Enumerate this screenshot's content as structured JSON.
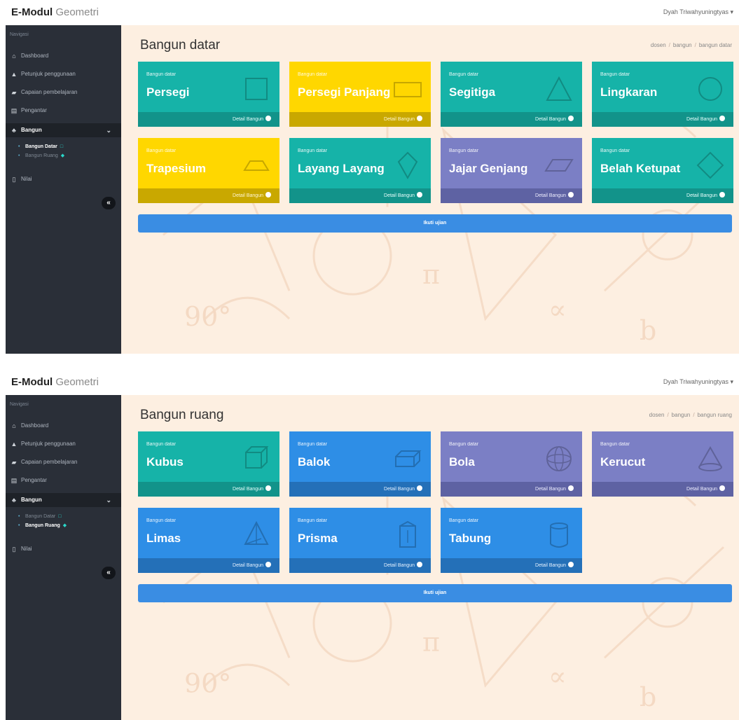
{
  "app": {
    "brand_bold": "E-Modul",
    "brand_light": "Geometri",
    "user": "Dyah Triwahyuningtyas ▾"
  },
  "nav": {
    "heading": "Navigasi",
    "items": [
      {
        "label": "Dashboard",
        "icon": "home-icon"
      },
      {
        "label": "Petunjuk penggunaan",
        "icon": "pointer-icon"
      },
      {
        "label": "Capaian pembelajaran",
        "icon": "graduation-cap-icon"
      },
      {
        "label": "Pengantar",
        "icon": "id-card-icon"
      },
      {
        "label": "Bangun",
        "icon": "shapes-icon"
      },
      {
        "label": "Nilai",
        "icon": "clipboard-icon"
      }
    ],
    "sub_items": [
      "Bangun Datar",
      "Bangun Ruang"
    ],
    "collapse": "«"
  },
  "screens": [
    {
      "title": "Bangun datar",
      "breadcrumb": [
        "dosen",
        "bangun",
        "bangun datar"
      ],
      "cards": [
        {
          "kicker": "Bangun datar",
          "title": "Persegi",
          "footer": "Detail Bangun",
          "color": "teal",
          "icon": "square-icon"
        },
        {
          "kicker": "Bangun datar",
          "title": "Persegi Panjang",
          "footer": "Detail Bangun",
          "color": "yellow",
          "icon": "rectangle-icon"
        },
        {
          "kicker": "Bangun datar",
          "title": "Segitiga",
          "footer": "Detail Bangun",
          "color": "teal",
          "icon": "triangle-icon"
        },
        {
          "kicker": "Bangun datar",
          "title": "Lingkaran",
          "footer": "Detail Bangun",
          "color": "teal",
          "icon": "circle-icon"
        },
        {
          "kicker": "Bangun datar",
          "title": "Trapesium",
          "footer": "Detail Bangun",
          "color": "yellow",
          "icon": "trapezoid-icon"
        },
        {
          "kicker": "Bangun datar",
          "title": "Layang Layang",
          "footer": "Detail Bangun",
          "color": "teal",
          "icon": "kite-icon"
        },
        {
          "kicker": "Bangun datar",
          "title": "Jajar Genjang",
          "footer": "Detail Bangun",
          "color": "purple",
          "icon": "parallelogram-icon"
        },
        {
          "kicker": "Bangun datar",
          "title": "Belah Ketupat",
          "footer": "Detail Bangun",
          "color": "teal",
          "icon": "rhombus-icon"
        }
      ],
      "exam_button": "Ikuti ujian"
    },
    {
      "title": "Bangun ruang",
      "breadcrumb": [
        "dosen",
        "bangun",
        "bangun ruang"
      ],
      "cards": [
        {
          "kicker": "Bangun datar",
          "title": "Kubus",
          "footer": "Detail Bangun",
          "color": "teal",
          "icon": "cube-icon"
        },
        {
          "kicker": "Bangun datar",
          "title": "Balok",
          "footer": "Detail Bangun",
          "color": "blue",
          "icon": "cuboid-icon"
        },
        {
          "kicker": "Bangun datar",
          "title": "Bola",
          "footer": "Detail Bangun",
          "color": "purple",
          "icon": "sphere-icon"
        },
        {
          "kicker": "Bangun datar",
          "title": "Kerucut",
          "footer": "Detail Bangun",
          "color": "purple",
          "icon": "cone-icon"
        },
        {
          "kicker": "Bangun datar",
          "title": "Limas",
          "footer": "Detail Bangun",
          "color": "blue",
          "icon": "pyramid-icon"
        },
        {
          "kicker": "Bangun datar",
          "title": "Prisma",
          "footer": "Detail Bangun",
          "color": "blue",
          "icon": "prism-icon"
        },
        {
          "kicker": "Bangun datar",
          "title": "Tabung",
          "footer": "Detail Bangun",
          "color": "blue",
          "icon": "cylinder-icon"
        }
      ],
      "exam_button": "Ikuti ujian"
    }
  ],
  "active_sub_item": [
    0,
    1
  ]
}
